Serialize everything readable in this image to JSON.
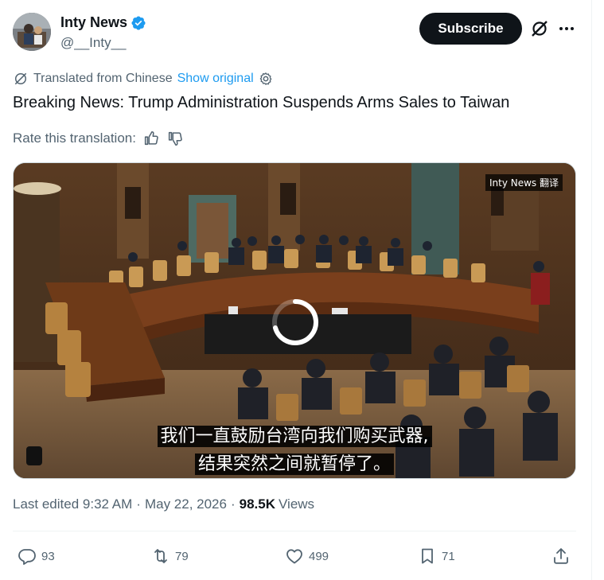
{
  "author": {
    "name": "Inty News",
    "handle": "@__Inty__",
    "avatar": "avatar-photo",
    "verified_icon": "verified-badge-icon",
    "verified_color": "#1d9bf0"
  },
  "header": {
    "subscribe_label": "Subscribe",
    "grok_icon": "grok-icon",
    "more_icon": "more-options-icon"
  },
  "translation": {
    "icon": "translate-icon",
    "note": "Translated from Chinese",
    "show_original": "Show original",
    "settings_icon": "gear-icon"
  },
  "tweet": {
    "text": "Breaking News: Trump Administration Suspends Arms Sales to Taiwan"
  },
  "rating": {
    "label": "Rate this translation:",
    "thumbs_up_icon": "thumbs-up-icon",
    "thumbs_down_icon": "thumbs-down-icon"
  },
  "media": {
    "type": "video",
    "watermark": "Inty News 翻译",
    "subtitle_line1": "我们一直鼓励台湾向我们购买武器,",
    "subtitle_line2": "结果突然之间就暂停了。",
    "loading_icon": "loading-spinner-icon"
  },
  "meta": {
    "edited": "Last edited 9:32 AM",
    "separator": "·",
    "date": "May 22, 2026",
    "views_count": "98.5K",
    "views_label": "Views"
  },
  "actions": {
    "replies": "93",
    "reposts": "79",
    "likes": "499",
    "bookmarks": "71"
  },
  "colors": {
    "accent": "#1d9bf0",
    "text_primary": "#0f1419",
    "text_secondary": "#536471"
  }
}
